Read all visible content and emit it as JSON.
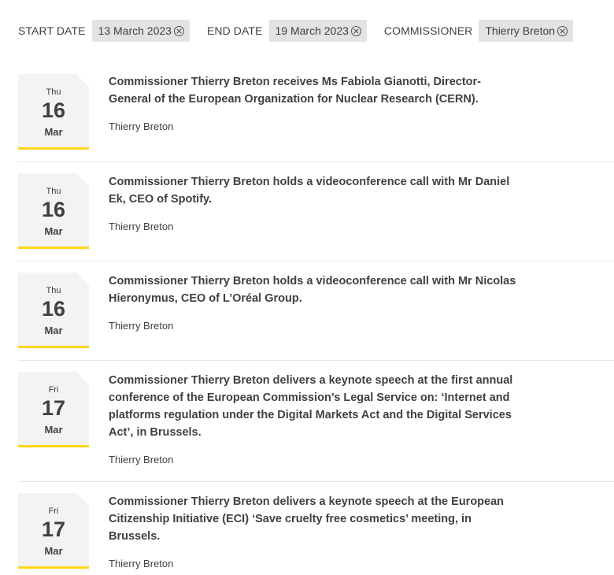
{
  "filters": [
    {
      "label": "START DATE",
      "value": "13 March 2023"
    },
    {
      "label": "END DATE",
      "value": "19 March 2023"
    },
    {
      "label": "COMMISSIONER",
      "value": "Thierry Breton"
    }
  ],
  "events": [
    {
      "dow": "Thu",
      "day": "16",
      "month": "Mar",
      "title": "Commissioner Thierry Breton receives Ms Fabiola Gianotti, Director-General of the European Organization for Nuclear Research (CERN).",
      "author": "Thierry Breton"
    },
    {
      "dow": "Thu",
      "day": "16",
      "month": "Mar",
      "title": "Commissioner Thierry Breton holds a videoconference call with Mr Daniel Ek, CEO of Spotify.",
      "author": "Thierry Breton"
    },
    {
      "dow": "Thu",
      "day": "16",
      "month": "Mar",
      "title": "Commissioner Thierry Breton holds a videoconference call with Mr Nicolas Hieronymus, CEO of L’Oréal Group.",
      "author": "Thierry Breton"
    },
    {
      "dow": "Fri",
      "day": "17",
      "month": "Mar",
      "title": "Commissioner Thierry Breton delivers a keynote speech at the first annual conference of the European Commission’s Legal Service on: ‘Internet and platforms regulation under the Digital Markets Act and the Digital Services Act’, in Brussels.",
      "author": "Thierry Breton"
    },
    {
      "dow": "Fri",
      "day": "17",
      "month": "Mar",
      "title": "Commissioner Thierry Breton delivers a keynote speech at the European Citizenship Initiative (ECI) ‘Save cruelty free cosmetics’ meeting, in Brussels.",
      "author": "Thierry Breton"
    }
  ],
  "colors": {
    "accent": "#ffd617",
    "chip_bg": "#e3e3e3",
    "date_bg": "#f3f3f3",
    "text": "#404040"
  },
  "icons": {
    "chip_remove": "close-circle-icon"
  }
}
